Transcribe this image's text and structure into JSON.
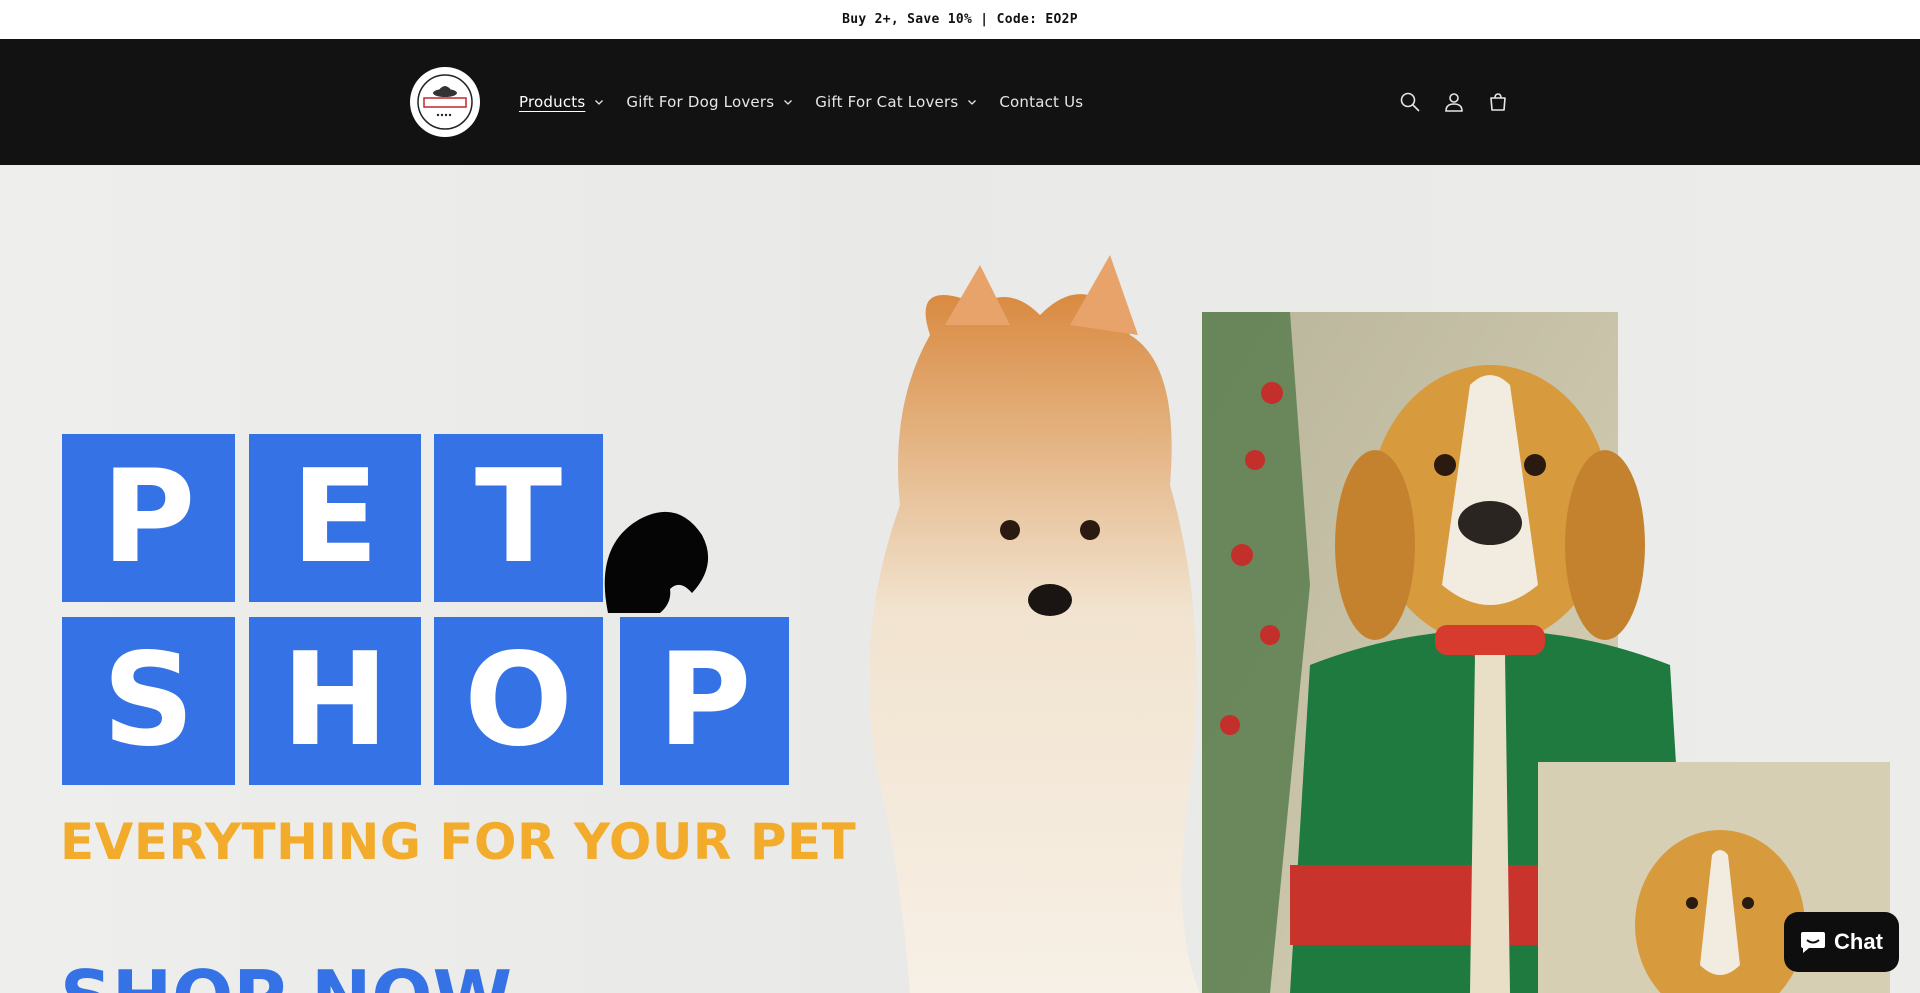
{
  "announcement": {
    "text": "Buy 2+, Save 10% | Code: EO2P"
  },
  "header": {
    "logo_text": "EO CRAFTWORKS",
    "nav": [
      {
        "label": "Products",
        "has_dropdown": true,
        "active": true
      },
      {
        "label": "Gift For Dog Lovers",
        "has_dropdown": true,
        "active": false
      },
      {
        "label": "Gift For Cat Lovers",
        "has_dropdown": true,
        "active": false
      },
      {
        "label": "Contact Us",
        "has_dropdown": false,
        "active": false
      }
    ],
    "icons": [
      "search-icon",
      "account-icon",
      "cart-icon"
    ]
  },
  "hero": {
    "tiles_row1": [
      "P",
      "E",
      "T"
    ],
    "tiles_row2": [
      "S",
      "H",
      "O",
      "P"
    ],
    "tagline": "EVERYTHING FOR YOUR PET",
    "cta": "SHOP NOW"
  },
  "chat": {
    "label": "Chat"
  },
  "colors": {
    "header_bg": "#121212",
    "tile_blue": "#3572e6",
    "tagline_orange": "#f3ab2c",
    "hero_bg": "#ececea"
  }
}
